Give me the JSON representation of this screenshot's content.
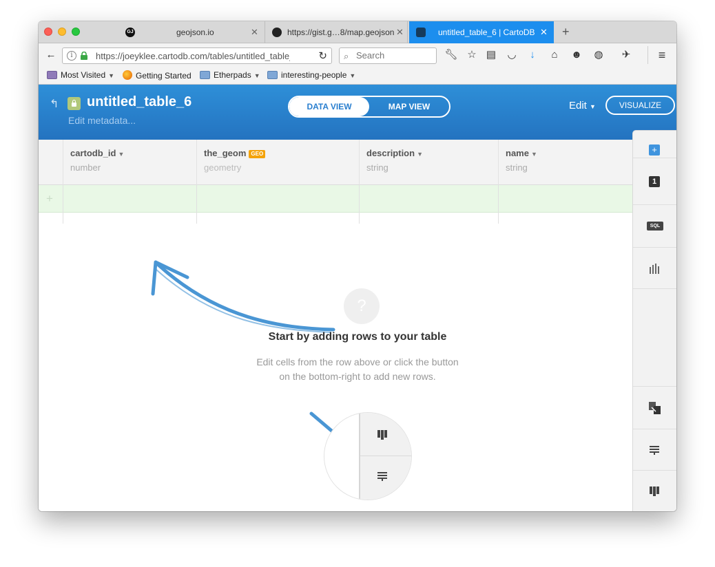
{
  "browser": {
    "tabs": [
      {
        "label": "geojson.io",
        "favicon": "geojson-favicon"
      },
      {
        "label": "https://gist.g…8/map.geojson",
        "favicon": "github-icon"
      },
      {
        "label": "untitled_table_6 | CartoDB",
        "favicon": "cartodb-icon",
        "active": true
      }
    ],
    "url": "https://joeyklee.cartodb.com/tables/untitled_table_6",
    "search_placeholder": "Search",
    "bookmarks": [
      {
        "label": "Most Visited",
        "has_menu": true
      },
      {
        "label": "Getting Started",
        "has_menu": false
      },
      {
        "label": "Etherpads",
        "has_menu": true
      },
      {
        "label": "interesting-people",
        "has_menu": true
      }
    ],
    "active_tab_color": "#1c8eee"
  },
  "header": {
    "title": "untitled_table_6",
    "subtitle": "Edit metadata...",
    "views": {
      "data": "DATA VIEW",
      "map": "MAP VIEW",
      "active": "data"
    },
    "edit_label": "Edit",
    "visualize_label": "VISUALIZE",
    "brand_color": "#2a84d2"
  },
  "table": {
    "columns": [
      {
        "name": "cartodb_id",
        "type": "number",
        "badge": ""
      },
      {
        "name": "the_geom",
        "type": "geometry",
        "badge": "GEO"
      },
      {
        "name": "description",
        "type": "string",
        "badge": ""
      },
      {
        "name": "name",
        "type": "string",
        "badge": ""
      }
    ],
    "add_row_symbol": "+"
  },
  "empty_state": {
    "icon": "?",
    "title": "Start by adding rows to your table",
    "description_line1": "Edit cells from the row above or click the button",
    "description_line2": "on the bottom-right to add new rows."
  },
  "sidebar": {
    "items": [
      {
        "icon": "add-layer-icon",
        "label": "+"
      },
      {
        "icon": "info-icon",
        "label": "1"
      },
      {
        "icon": "sql-icon",
        "label": "SQL"
      },
      {
        "icon": "histogram-icon",
        "label": ""
      },
      {
        "icon": "merge-icon",
        "label": ""
      },
      {
        "icon": "add-row-icon",
        "label": ""
      },
      {
        "icon": "add-column-icon",
        "label": ""
      }
    ]
  }
}
